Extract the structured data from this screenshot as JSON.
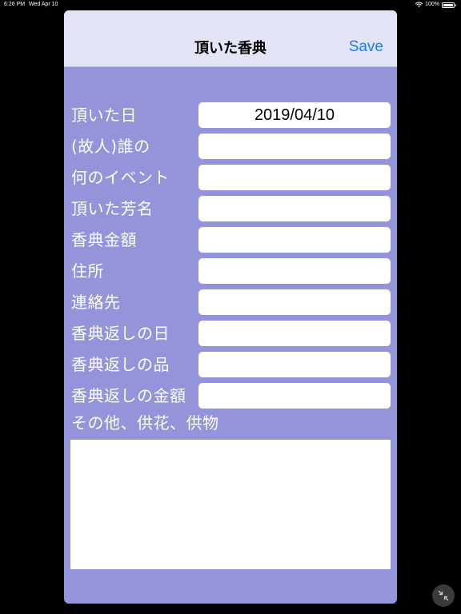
{
  "status_bar": {
    "time": "6:26 PM",
    "date": "Wed Apr 10",
    "battery": "100%"
  },
  "nav": {
    "title": "頂いた香典",
    "save_label": "Save"
  },
  "form": {
    "fields": [
      {
        "label": "頂いた日",
        "value": "2019/04/10"
      },
      {
        "label": "(故人)誰の",
        "value": ""
      },
      {
        "label": "何のイベント",
        "value": ""
      },
      {
        "label": "頂いた芳名",
        "value": ""
      },
      {
        "label": "香典金額",
        "value": ""
      },
      {
        "label": "住所",
        "value": ""
      },
      {
        "label": "連絡先",
        "value": ""
      },
      {
        "label": "香典返しの日",
        "value": ""
      },
      {
        "label": "香典返しの品",
        "value": ""
      },
      {
        "label": "香典返しの金額",
        "value": ""
      }
    ],
    "other_label": "その他、供花、供物",
    "other_value": ""
  },
  "colors": {
    "sheet_background": "#9394d9",
    "nav_background": "#e4e4f7",
    "accent": "#1d7cf2"
  }
}
